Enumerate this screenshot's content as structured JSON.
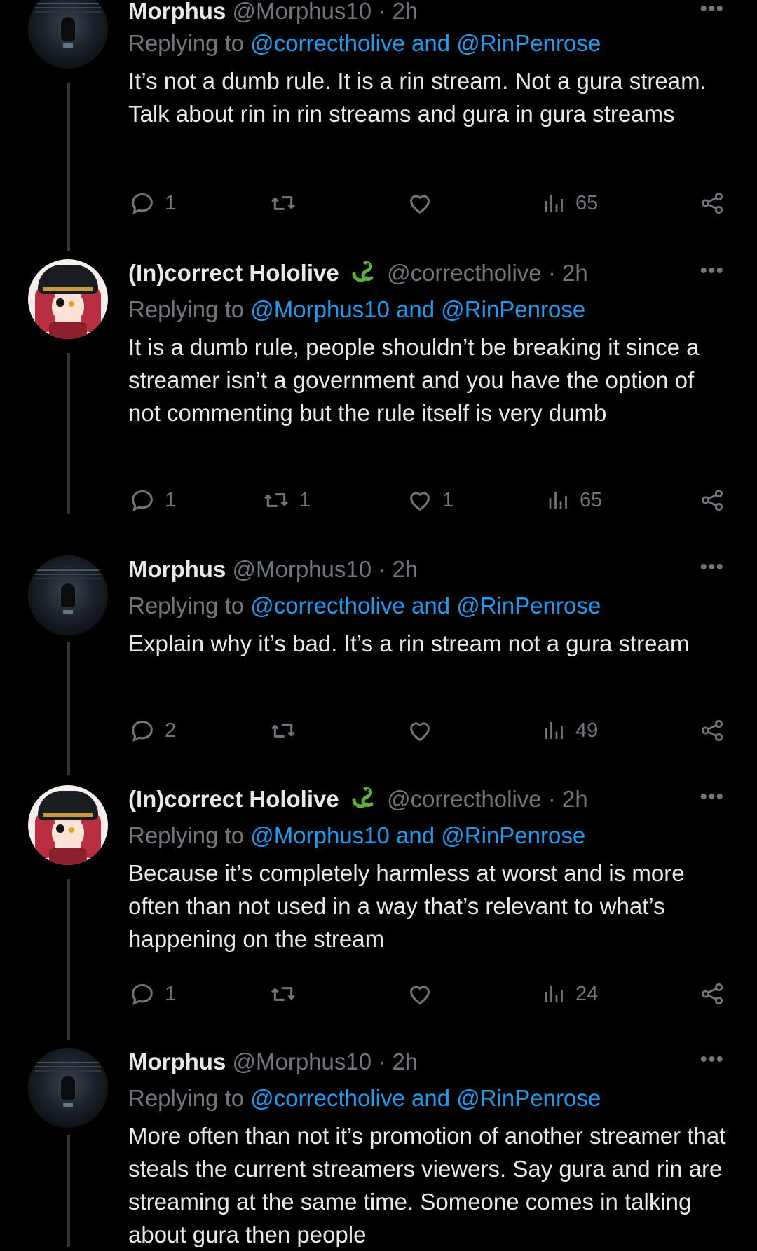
{
  "tweets": [
    {
      "name": "Morphus",
      "handle": "@Morphus10",
      "time": "2h",
      "avatar": "dark-figure",
      "reply_prefix": "Replying to",
      "mentions": "@correctholive and @RinPenrose",
      "text": "It’s not a dumb rule. It is a rin stream. Not a gura stream. Talk about rin in rin streams and gura in gura streams",
      "replies": "1",
      "retweets": "",
      "likes": "",
      "views": "65"
    },
    {
      "name": "(In)correct Hololive",
      "handle": "@correctholive",
      "time": "2h",
      "avatar": "anime-pirate",
      "reply_prefix": "Replying to",
      "mentions": "@Morphus10 and @RinPenrose",
      "text": "It is a dumb rule, people shouldn’t be breaking it since a streamer isn’t a government and you have the option of not commenting but the rule itself is very dumb",
      "replies": "1",
      "retweets": "1",
      "likes": "1",
      "views": "65"
    },
    {
      "name": "Morphus",
      "handle": "@Morphus10",
      "time": "2h",
      "avatar": "dark-figure",
      "reply_prefix": "Replying to",
      "mentions": "@correctholive and @RinPenrose",
      "text": "Explain why it’s bad. It’s a rin stream not a gura stream",
      "replies": "2",
      "retweets": "",
      "likes": "",
      "views": "49"
    },
    {
      "name": "(In)correct Hololive",
      "handle": "@correctholive",
      "time": "2h",
      "avatar": "anime-pirate",
      "reply_prefix": "Replying to",
      "mentions": "@Morphus10 and @RinPenrose",
      "text": "Because it’s completely harmless at worst and is more often than not used in a way that’s relevant to what’s happening on the stream",
      "replies": "1",
      "retweets": "",
      "likes": "",
      "views": "24"
    },
    {
      "name": "Morphus",
      "handle": "@Morphus10",
      "time": "2h",
      "avatar": "dark-figure",
      "reply_prefix": "Replying to",
      "mentions": "@correctholive and @RinPenrose",
      "text": "More often than not it’s promotion of another streamer that steals the current streamers viewers. Say gura and rin are streaming at the same time. Someone comes in talking about gura then people",
      "replies": "",
      "retweets": "",
      "likes": "",
      "views": ""
    }
  ],
  "separator_dot": "·",
  "colors": {
    "background": "#000000",
    "text": "#e7e9ea",
    "muted": "#71767b",
    "link": "#1d9bf0",
    "thread_line": "#333639"
  },
  "icons": [
    "reply-icon",
    "retweet-icon",
    "like-icon",
    "views-icon",
    "share-icon",
    "more-icon",
    "snake-emoji"
  ]
}
